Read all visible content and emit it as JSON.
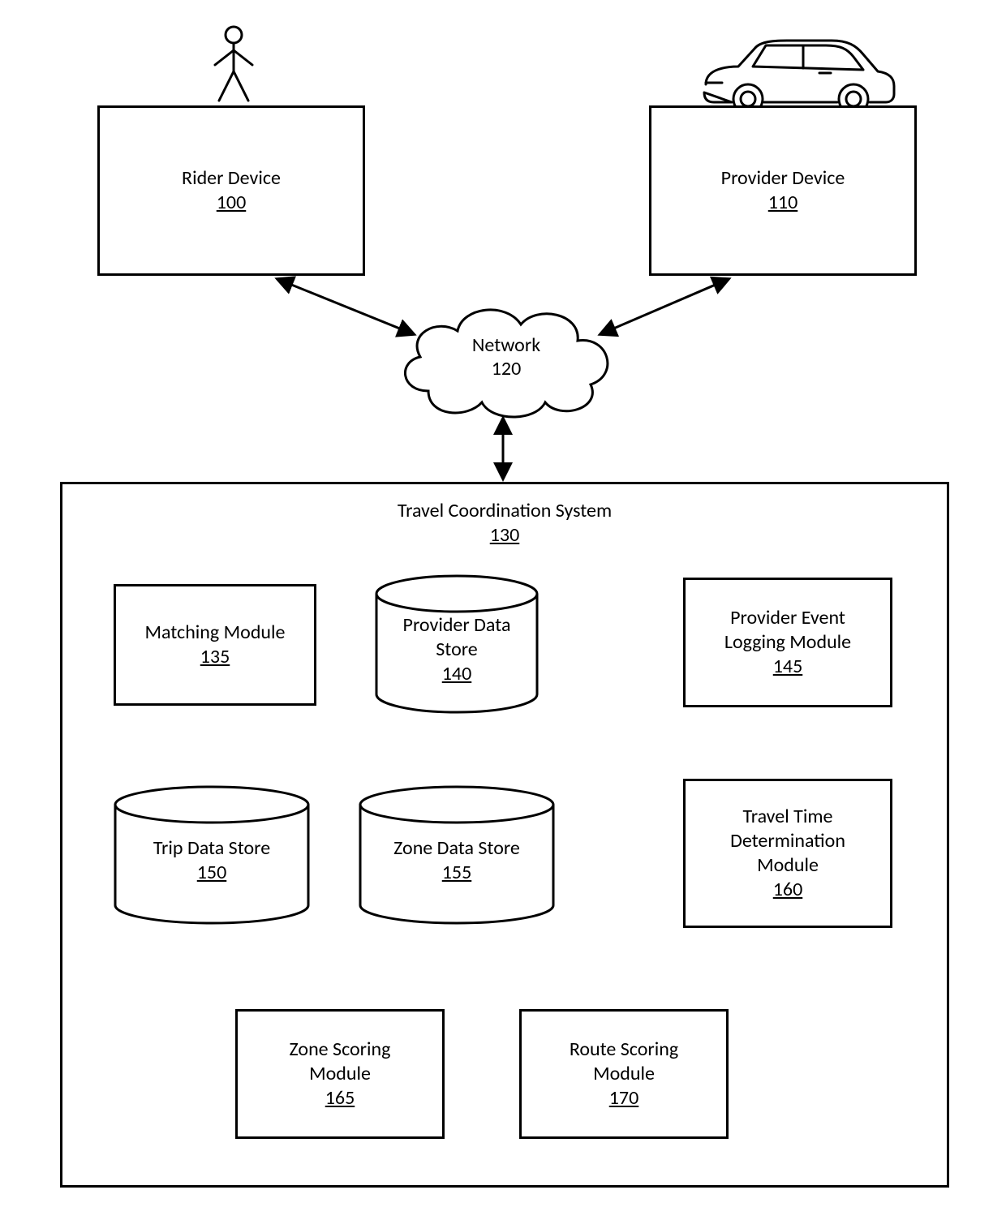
{
  "rider": {
    "label": "Rider Device",
    "ref": "100"
  },
  "provider": {
    "label": "Provider Device",
    "ref": "110"
  },
  "network": {
    "label": "Network",
    "ref": "120"
  },
  "system": {
    "label": "Travel Coordination System",
    "ref": "130"
  },
  "modules": {
    "matching": {
      "label": "Matching Module",
      "ref": "135"
    },
    "providerStore": {
      "label": "Provider Data Store",
      "ref": "140"
    },
    "providerEvent": {
      "label": "Provider Event Logging Module",
      "ref": "145"
    },
    "tripStore": {
      "label": "Trip Data Store",
      "ref": "150"
    },
    "zoneStore": {
      "label": "Zone Data Store",
      "ref": "155"
    },
    "travelTime": {
      "label": "Travel Time Determination Module",
      "ref": "160"
    },
    "zoneScoring": {
      "label": "Zone Scoring Module",
      "ref": "165"
    },
    "routeScoring": {
      "label": "Route Scoring Module",
      "ref": "170"
    }
  }
}
